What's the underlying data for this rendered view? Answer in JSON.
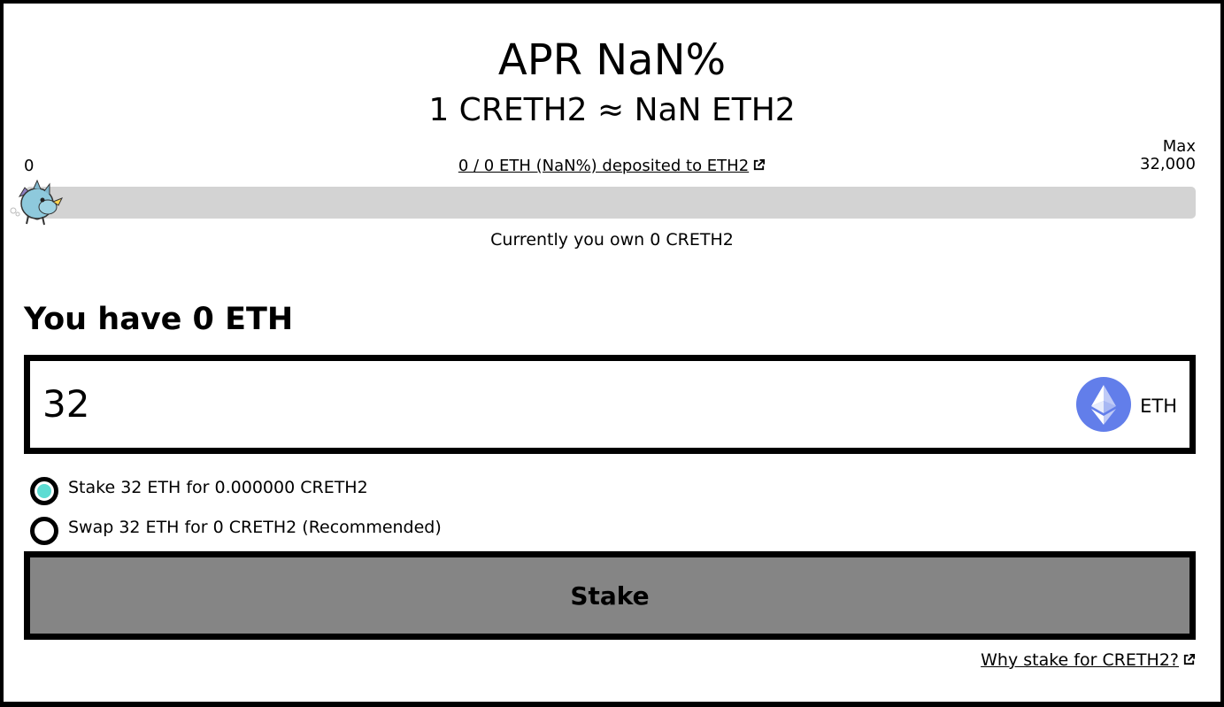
{
  "header": {
    "apr_text": "APR NaN%",
    "rate_text": "1 CRETH2 ≈ NaN ETH2"
  },
  "progress": {
    "min_label": "0",
    "max_title": "Max",
    "max_value": "32,000",
    "deposited_text": "0 / 0 ETH (NaN%) deposited to ETH2",
    "fill_fraction": 0,
    "owned_text": "Currently you own 0 CRETH2"
  },
  "wallet": {
    "balance_text": "You have 0 ETH"
  },
  "amount_input": {
    "value": "32",
    "unit": "ETH",
    "icon": "ethereum-icon"
  },
  "options": [
    {
      "label": "Stake 32 ETH for 0.000000 CRETH2",
      "selected": true
    },
    {
      "label": "Swap 32 ETH for 0 CRETH2 (Recommended)",
      "selected": false
    }
  ],
  "stake_button": {
    "label": "Stake"
  },
  "footer": {
    "why_link": "Why stake for CRETH2?"
  },
  "colors": {
    "track": "#d3d3d3",
    "radio_selected": "#5ddcd3",
    "button": "#858585",
    "eth_logo": "#627eea"
  }
}
